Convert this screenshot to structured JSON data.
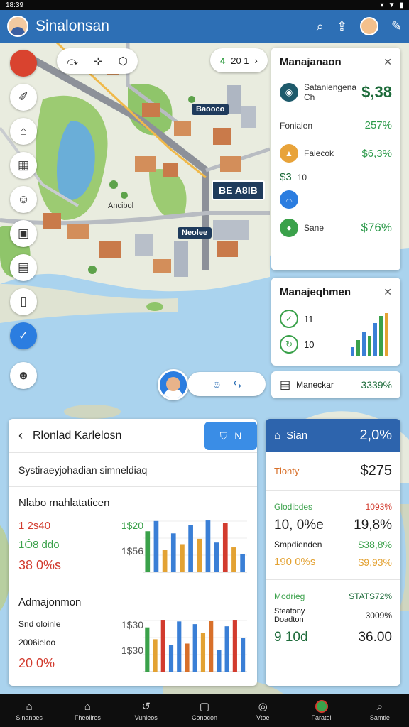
{
  "status_bar": {
    "time": "18:39"
  },
  "app_bar": {
    "title": "Sinalonsan"
  },
  "map": {
    "labels": [
      "Baooco",
      "BE A8IB",
      "Ancibol",
      "Neolee"
    ],
    "top_chip": {
      "icon_text": "4",
      "value": "20 1"
    }
  },
  "mgmt_card_1": {
    "title": "Manajanaon",
    "rows": [
      {
        "label": "Sataniengena",
        "sub": "Ch",
        "value": "$,38"
      },
      {
        "label": "Foniaien",
        "sub": "",
        "value": "257%"
      },
      {
        "label": "Faiecok",
        "sub": "",
        "value": "$6,3%"
      },
      {
        "label": "$3",
        "sub": "10",
        "value": ""
      },
      {
        "label": "",
        "sub": "",
        "value": ""
      },
      {
        "label": "Sane",
        "sub": "",
        "value": "$76%"
      }
    ]
  },
  "mgmt_card_2": {
    "title": "Manajeqhmen",
    "rows": [
      {
        "value": "11"
      },
      {
        "value": "10"
      }
    ]
  },
  "monitor": {
    "label": "Maneckar",
    "value": "3339%"
  },
  "sheet": {
    "title": "Rlonlad Karlelosn",
    "subtitle": "Systiraeyjohadian simneldiaq",
    "section1": {
      "title": "Nlabo mahlataticen",
      "stats": [
        "1 2s40",
        "1Ó8 ddo",
        "38 0%s"
      ],
      "stats2": [
        "1$20",
        "",
        "1$56"
      ]
    },
    "section2": {
      "title": "Admajonmon",
      "stats": [
        "Snd oloinle",
        "2006ieloo",
        "20 0%"
      ],
      "stats2": [
        "1$30",
        "",
        "1$30"
      ]
    },
    "chart1": [
      {
        "h": 0.76,
        "c": "#3aa14a"
      },
      {
        "h": 0.95,
        "c": "#3a7fd6"
      },
      {
        "h": 0.42,
        "c": "#e3a233"
      },
      {
        "h": 0.72,
        "c": "#3a7fd6"
      },
      {
        "h": 0.52,
        "c": "#e3a233"
      },
      {
        "h": 0.88,
        "c": "#3a7fd6"
      },
      {
        "h": 0.62,
        "c": "#e3a233"
      },
      {
        "h": 0.96,
        "c": "#3a7fd6"
      },
      {
        "h": 0.55,
        "c": "#3a7fd6"
      },
      {
        "h": 0.92,
        "c": "#d23b2e"
      },
      {
        "h": 0.46,
        "c": "#e3a233"
      },
      {
        "h": 0.34,
        "c": "#3a7fd6"
      }
    ],
    "chart2": [
      {
        "h": 0.82,
        "c": "#3aa14a"
      },
      {
        "h": 0.6,
        "c": "#e3a233"
      },
      {
        "h": 0.96,
        "c": "#d23b2e"
      },
      {
        "h": 0.5,
        "c": "#3a7fd6"
      },
      {
        "h": 0.93,
        "c": "#3a7fd6"
      },
      {
        "h": 0.52,
        "c": "#d8702a"
      },
      {
        "h": 0.88,
        "c": "#3a7fd6"
      },
      {
        "h": 0.72,
        "c": "#e3a233"
      },
      {
        "h": 0.94,
        "c": "#d8702a"
      },
      {
        "h": 0.4,
        "c": "#3a7fd6"
      },
      {
        "h": 0.84,
        "c": "#3a7fd6"
      },
      {
        "h": 0.96,
        "c": "#d23b2e"
      },
      {
        "h": 0.62,
        "c": "#3a7fd6"
      }
    ],
    "button_text": "N"
  },
  "right_card": {
    "head_label": "Sian",
    "head_value": "2,0%",
    "row1": {
      "label": "Tlonty",
      "value": "$275"
    },
    "sec1": {
      "rows": [
        {
          "l": "Glodibdes",
          "v": "1093%"
        },
        {
          "l": "10, 0%e",
          "v": "19,8%"
        },
        {
          "l": "Smpdienden",
          "v": "$38,8%"
        },
        {
          "l": "190 0%s",
          "v": "$9,93%"
        }
      ]
    },
    "sec2": {
      "rows": [
        {
          "l": "Modrieg",
          "v": "STATS72%"
        },
        {
          "l": "Steatony\nDoadton",
          "v": "3009%"
        },
        {
          "l": "9 10d",
          "v": "36.00"
        }
      ]
    }
  },
  "bottom_nav": [
    {
      "label": "Sinanbes",
      "icon": "home-icon"
    },
    {
      "label": "Fheoiires",
      "icon": "house-icon"
    },
    {
      "label": "Vunleos",
      "icon": "curve-icon"
    },
    {
      "label": "Conocon",
      "icon": "square-icon"
    },
    {
      "label": "Vtoe",
      "icon": "circle-icon"
    },
    {
      "label": "Faratoi",
      "icon": "map-pin-icon"
    },
    {
      "label": "Samtie",
      "icon": "search-icon"
    }
  ],
  "colors": {
    "primary": "#2d6fb5",
    "accent_blue": "#3a8de6",
    "green": "#3aa14a",
    "water": "#aad3ee"
  }
}
